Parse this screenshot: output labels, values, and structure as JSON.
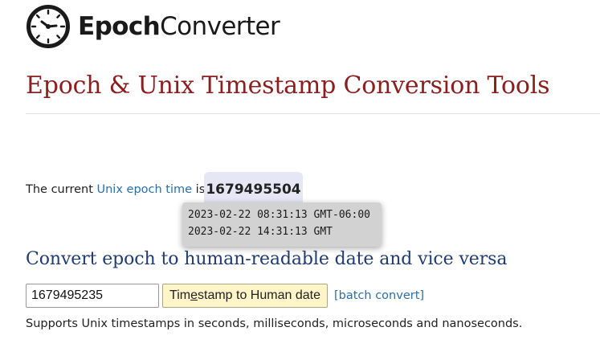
{
  "brand": {
    "name_bold": "Epoch",
    "name_light": "Converter"
  },
  "page_title": "Epoch & Unix Timestamp Conversion Tools",
  "current": {
    "prefix": "The current ",
    "link_text": "Unix epoch time",
    "suffix": " is",
    "epoch_value": "1679495504"
  },
  "tooltip": {
    "local_time": "2023-02-22 08:31:13 GMT-06:00",
    "gmt_time": "2023-02-22 14:31:13 GMT"
  },
  "converter": {
    "heading": "Convert epoch to human-readable date and vice versa",
    "input_value": "1679495235",
    "button_label_pre": "Ti",
    "button_label_accesskey": "m",
    "button_label_mid": "",
    "button_label_e": "e",
    "button_label_post": "stamp to Human date",
    "batch_link": "[batch convert]",
    "supports_note": "Supports Unix timestamps in seconds, milliseconds, microseconds and nanoseconds."
  },
  "colors": {
    "title": "#8b1e1e",
    "heading": "#1f3c73",
    "link": "#2a6fa8",
    "button_bg": "#fff5c8",
    "epoch_box_bg": "#e6e6f5",
    "tooltip_bg": "#d2d2d2"
  },
  "icons": {
    "logo": "clock-icon"
  }
}
